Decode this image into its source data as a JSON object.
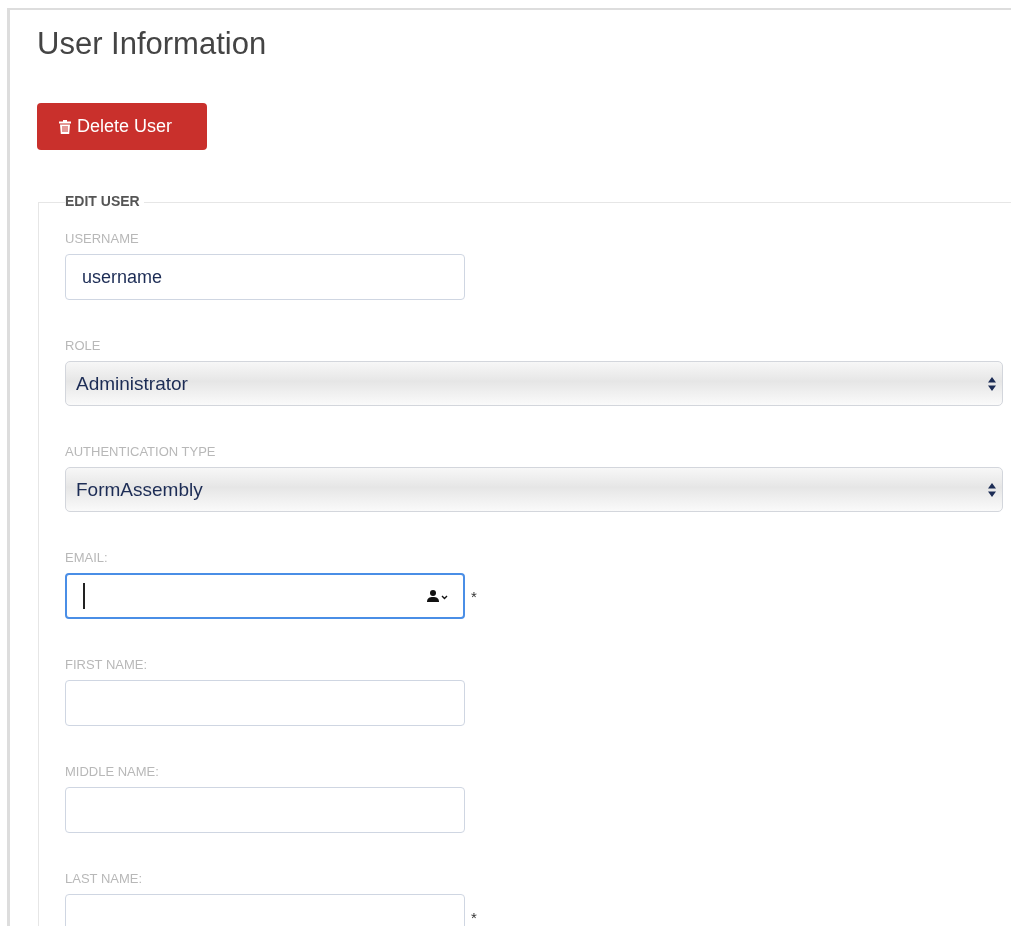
{
  "title": "User Information",
  "delete_button": {
    "label": "Delete User"
  },
  "fieldset": {
    "legend": "EDIT USER",
    "fields": [
      {
        "kind": "text",
        "label": "USERNAME",
        "value": "username",
        "focused": false,
        "required": false,
        "autofill_icon": false
      },
      {
        "kind": "select",
        "label": "ROLE",
        "value": "Administrator"
      },
      {
        "kind": "select",
        "label": "AUTHENTICATION TYPE",
        "value": "FormAssembly"
      },
      {
        "kind": "text",
        "label": "EMAIL:",
        "focused": true,
        "required": true,
        "autofill_icon": true
      },
      {
        "kind": "text",
        "label": "FIRST NAME:",
        "focused": false,
        "required": false,
        "autofill_icon": false
      },
      {
        "kind": "text",
        "label": "MIDDLE NAME:",
        "focused": false,
        "required": false,
        "autofill_icon": false
      },
      {
        "kind": "text",
        "label": "LAST NAME:",
        "focused": false,
        "required": true,
        "autofill_icon": false
      }
    ]
  },
  "required_mark": "*"
}
